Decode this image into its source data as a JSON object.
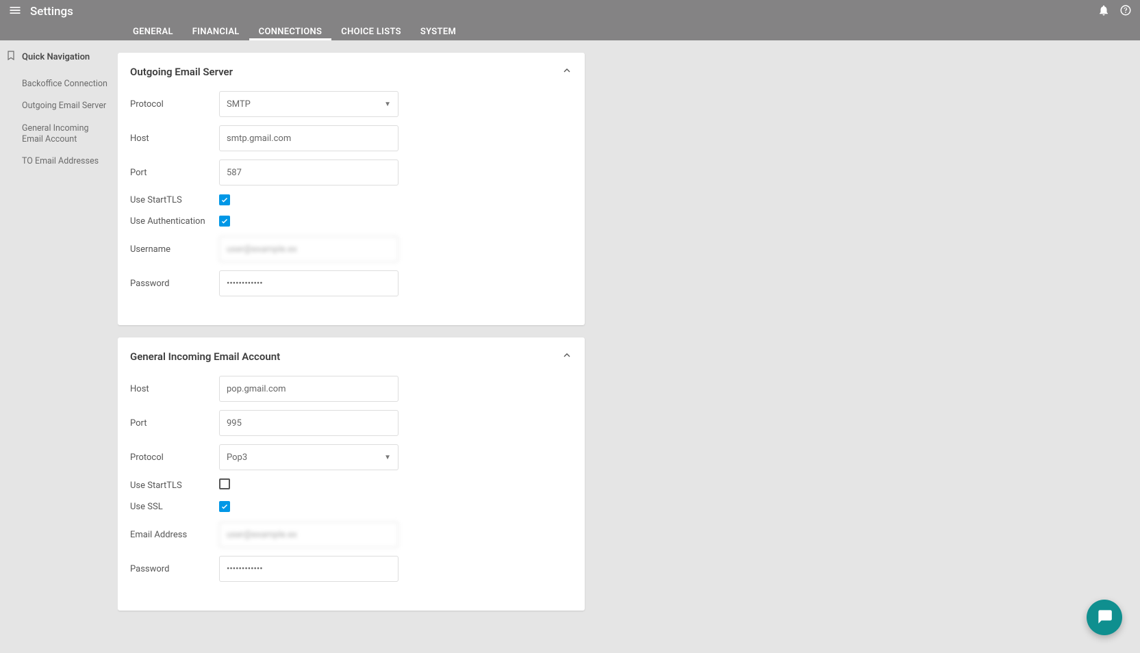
{
  "header": {
    "title": "Settings"
  },
  "tabs": [
    {
      "label": "GENERAL"
    },
    {
      "label": "FINANCIAL"
    },
    {
      "label": "CONNECTIONS",
      "active": true
    },
    {
      "label": "CHOICE LISTS"
    },
    {
      "label": "SYSTEM"
    }
  ],
  "sidebar": {
    "heading": "Quick Navigation",
    "items": [
      {
        "label": "Backoffice Connection"
      },
      {
        "label": "Outgoing Email Server"
      },
      {
        "label": "General Incoming Email Account"
      },
      {
        "label": "TO Email Addresses"
      }
    ]
  },
  "card_outgoing": {
    "title": "Outgoing Email Server",
    "protocol_label": "Protocol",
    "protocol_value": "SMTP",
    "host_label": "Host",
    "host_value": "smtp.gmail.com",
    "port_label": "Port",
    "port_value": "587",
    "starttls_label": "Use StartTLS",
    "starttls_checked": true,
    "auth_label": "Use Authentication",
    "auth_checked": true,
    "username_label": "Username",
    "username_value": "user@example.ex",
    "password_label": "Password",
    "password_value": "••••••••••••"
  },
  "card_incoming": {
    "title": "General Incoming Email Account",
    "host_label": "Host",
    "host_value": "pop.gmail.com",
    "port_label": "Port",
    "port_value": "995",
    "protocol_label": "Protocol",
    "protocol_value": "Pop3",
    "starttls_label": "Use StartTLS",
    "starttls_checked": false,
    "ssl_label": "Use SSL",
    "ssl_checked": true,
    "email_label": "Email Address",
    "email_value": "user@example.ex",
    "password_label": "Password",
    "password_value": "••••••••••••"
  }
}
